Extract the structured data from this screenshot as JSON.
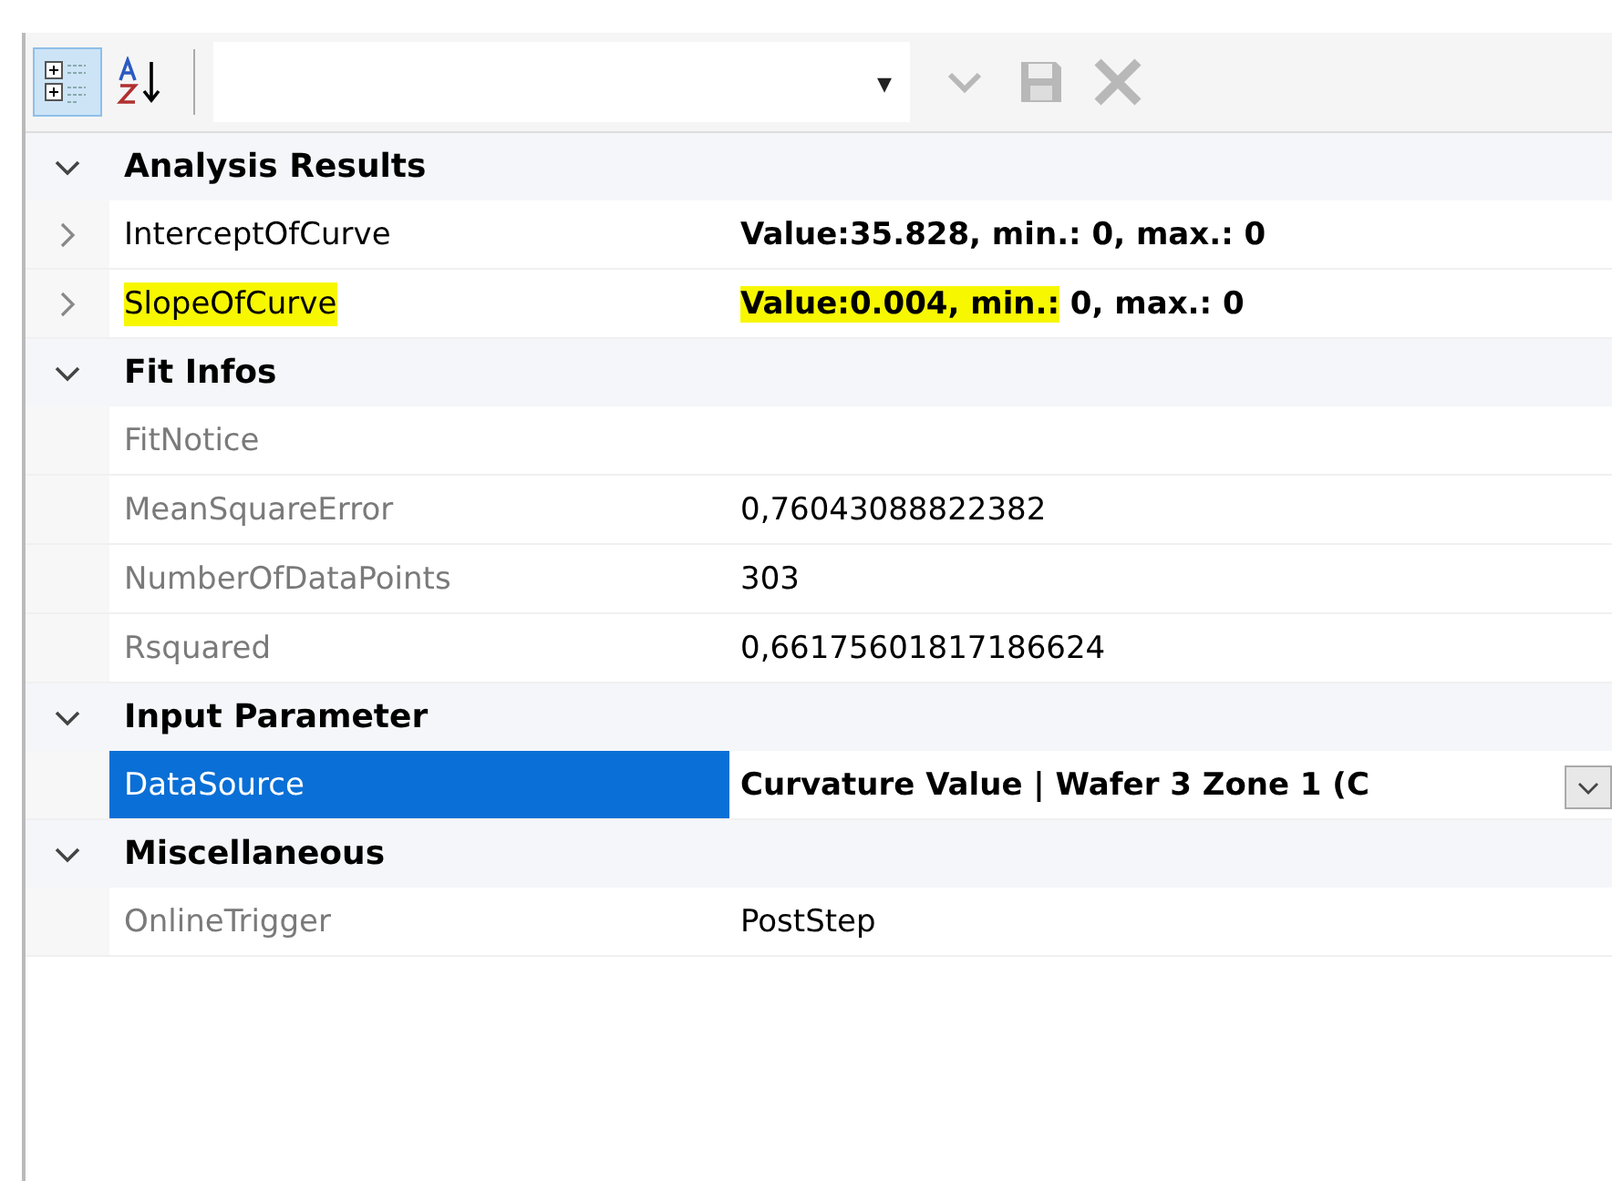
{
  "toolbar": {
    "view_buttons": [
      {
        "kind": "categorized",
        "selected": true
      },
      {
        "kind": "alphabetical",
        "selected": false
      }
    ],
    "combo": {
      "caret": "▾"
    },
    "actions": [
      {
        "kind": "check",
        "disabled": true
      },
      {
        "kind": "save",
        "disabled": true
      },
      {
        "kind": "delete",
        "disabled": true
      }
    ]
  },
  "categories": [
    {
      "name": "Analysis Results",
      "expanded": true,
      "properties": [
        {
          "name": "InterceptOfCurve",
          "expandable": true,
          "readonly": false,
          "highlighted": false,
          "selected": false,
          "value_parts": [
            {
              "text": "Value:35.828, min.: 0, max.: 0",
              "highlighted": false
            }
          ]
        },
        {
          "name": "SlopeOfCurve",
          "expandable": true,
          "readonly": false,
          "highlighted": true,
          "selected": false,
          "value_parts": [
            {
              "text": "Value:0.004, min.:",
              "highlighted": true
            },
            {
              "text": " 0, max.: 0",
              "highlighted": false
            }
          ]
        }
      ]
    },
    {
      "name": "Fit Infos",
      "expanded": true,
      "properties": [
        {
          "name": "FitNotice",
          "expandable": false,
          "readonly": true,
          "highlighted": false,
          "selected": false
        },
        {
          "name": "MeanSquareError",
          "expandable": false,
          "readonly": true,
          "highlighted": false,
          "selected": false,
          "value_parts": [
            {
              "text": "0,76043088822382",
              "highlighted": false
            }
          ]
        },
        {
          "name": "NumberOfDataPoints",
          "expandable": false,
          "readonly": true,
          "highlighted": false,
          "selected": false,
          "value_parts": [
            {
              "text": "303",
              "highlighted": false
            }
          ]
        },
        {
          "name": "Rsquared",
          "expandable": false,
          "readonly": true,
          "highlighted": false,
          "selected": false,
          "value_parts": [
            {
              "text": "0,66175601817186624",
              "highlighted": false
            }
          ]
        }
      ]
    },
    {
      "name": "Input Parameter",
      "expanded": true,
      "properties": [
        {
          "name": "DataSource",
          "expandable": false,
          "readonly": false,
          "highlighted": false,
          "selected": true,
          "dropdown": true,
          "value_parts": [
            {
              "text": "Curvature Value | Wafer 3 Zone 1 (C",
              "highlighted": false
            }
          ]
        }
      ]
    },
    {
      "name": "Miscellaneous",
      "expanded": true,
      "properties": [
        {
          "name": "OnlineTrigger",
          "expandable": false,
          "readonly": true,
          "highlighted": false,
          "selected": false,
          "value_parts": [
            {
              "text": "PostStep",
              "highlighted": false
            }
          ]
        }
      ]
    }
  ]
}
